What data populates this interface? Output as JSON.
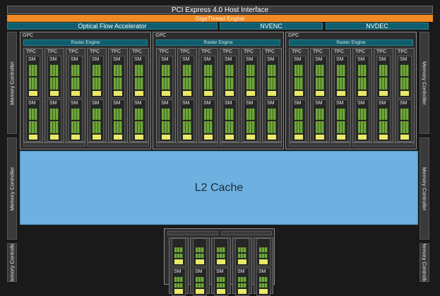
{
  "header": {
    "pcie": "PCI Express 4.0 Host Interface",
    "gigathread": "GigaThread Engine",
    "optical_flow": "Optical Flow Accelerator",
    "nvenc": "NVENC",
    "nvdec": "NVDEC"
  },
  "memory_controller_label": "Memory Controller",
  "gpc": {
    "label": "GPC",
    "raster_engine": "Raster Engine",
    "tpc_label": "TPC",
    "sm_label": "SM"
  },
  "l2_cache": "L2 Cache",
  "colors": {
    "gigathread": "#f28a24",
    "teal_block": "#0f5e6e",
    "l2_cache": "#6cb1e0",
    "cuda_cores": "#6fa83a",
    "tex_units": "#e8e86a"
  }
}
